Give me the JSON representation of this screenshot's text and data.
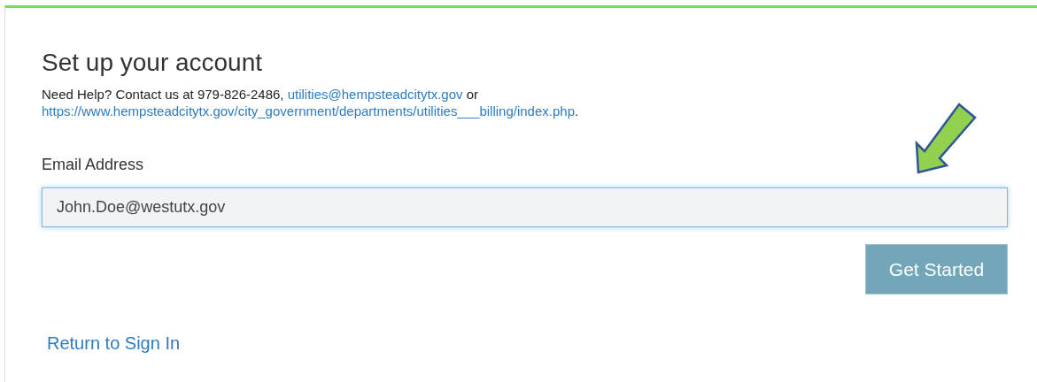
{
  "title": "Set up your account",
  "help": [
    {
      "kind": "text",
      "text": "Need Help? Contact us at 979-826-2486, "
    },
    {
      "kind": "link",
      "text": "utilities@hempsteadcitytx.gov"
    },
    {
      "kind": "text",
      "text": " or "
    },
    {
      "kind": "link",
      "text": "https://www.hempsteadcitytx.gov/city_government/departments/utilities___billing/index.php"
    },
    {
      "kind": "text",
      "text": "."
    }
  ],
  "email": {
    "label": "Email Address",
    "value": "John.Doe@westutx.gov",
    "focused": true
  },
  "submit": "Get Started",
  "return_link": "Return to Sign In"
}
